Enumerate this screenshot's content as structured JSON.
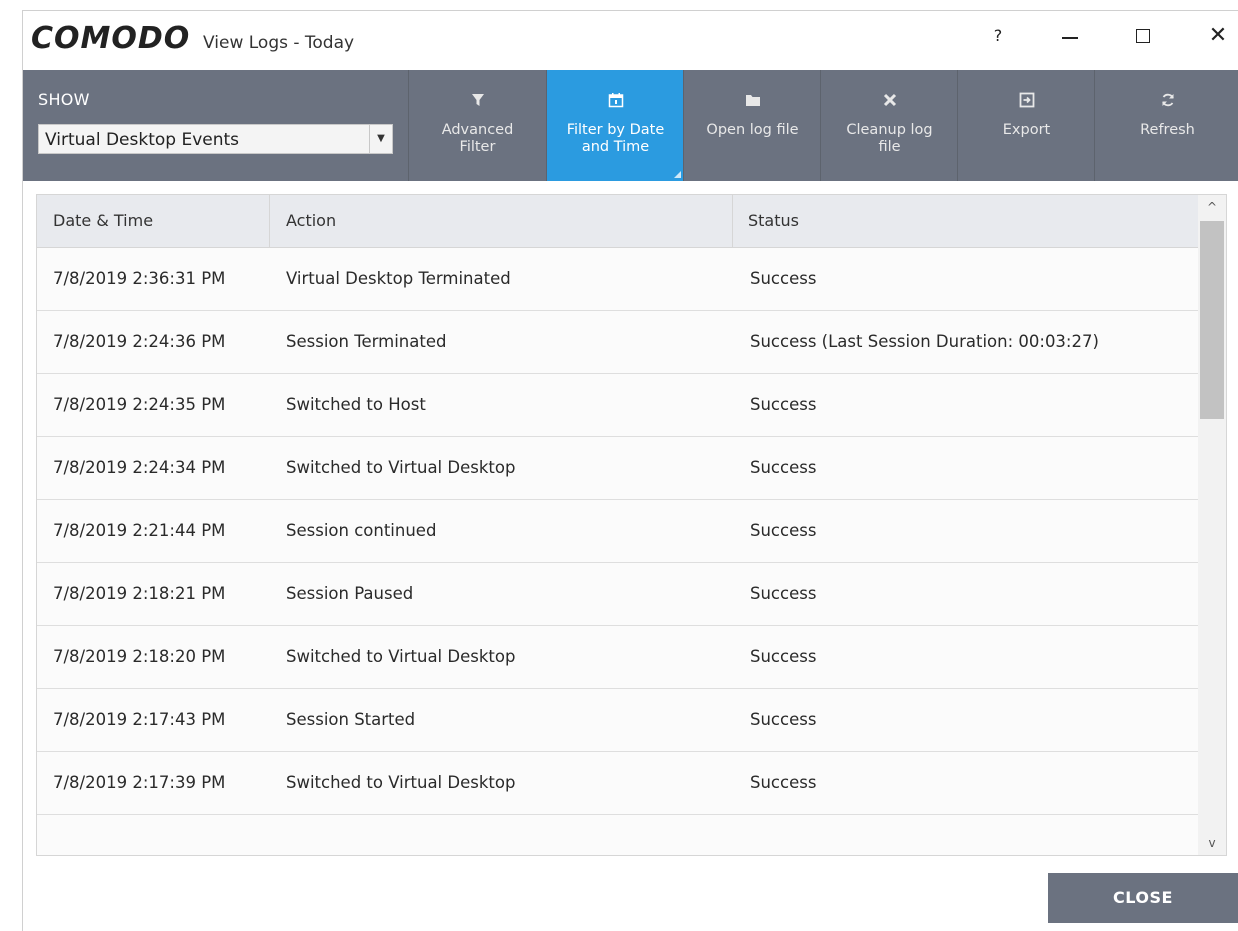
{
  "window": {
    "logo": "COMODO",
    "title": "View Logs - Today",
    "controls": {
      "help": "?",
      "close": "✕"
    }
  },
  "toolbar": {
    "show_label": "SHOW",
    "show_value": "Virtual Desktop Events",
    "buttons": [
      {
        "label": "Advanced\nFilter",
        "icon": "filter-icon"
      },
      {
        "label": "Filter by Date\nand Time",
        "icon": "calendar-icon",
        "active": true
      },
      {
        "label": "Open log file",
        "icon": "folder-icon"
      },
      {
        "label": "Cleanup log\nfile",
        "icon": "x-icon"
      },
      {
        "label": "Export",
        "icon": "export-icon"
      },
      {
        "label": "Refresh",
        "icon": "refresh-icon"
      }
    ],
    "colors": {
      "toolbar_bg": "#6b7280",
      "active_bg": "#2b9be0"
    }
  },
  "table": {
    "headers": [
      "Date & Time",
      "Action",
      "Status"
    ],
    "rows": [
      [
        "7/8/2019 2:36:31 PM",
        "Virtual Desktop Terminated",
        "Success"
      ],
      [
        "7/8/2019 2:24:36 PM",
        "Session Terminated",
        "Success (Last Session Duration: 00:03:27)"
      ],
      [
        "7/8/2019 2:24:35 PM",
        "Switched to Host",
        "Success"
      ],
      [
        "7/8/2019 2:24:34 PM",
        "Switched to Virtual Desktop",
        "Success"
      ],
      [
        "7/8/2019 2:21:44 PM",
        "Session continued",
        "Success"
      ],
      [
        "7/8/2019 2:18:21 PM",
        "Session Paused",
        "Success"
      ],
      [
        "7/8/2019 2:18:20 PM",
        "Switched to Virtual Desktop",
        "Success"
      ],
      [
        "7/8/2019 2:17:43 PM",
        "Session Started",
        "Success"
      ],
      [
        "7/8/2019 2:17:39 PM",
        "Switched to Virtual Desktop",
        "Success"
      ]
    ]
  },
  "footer": {
    "close_label": "CLOSE"
  }
}
